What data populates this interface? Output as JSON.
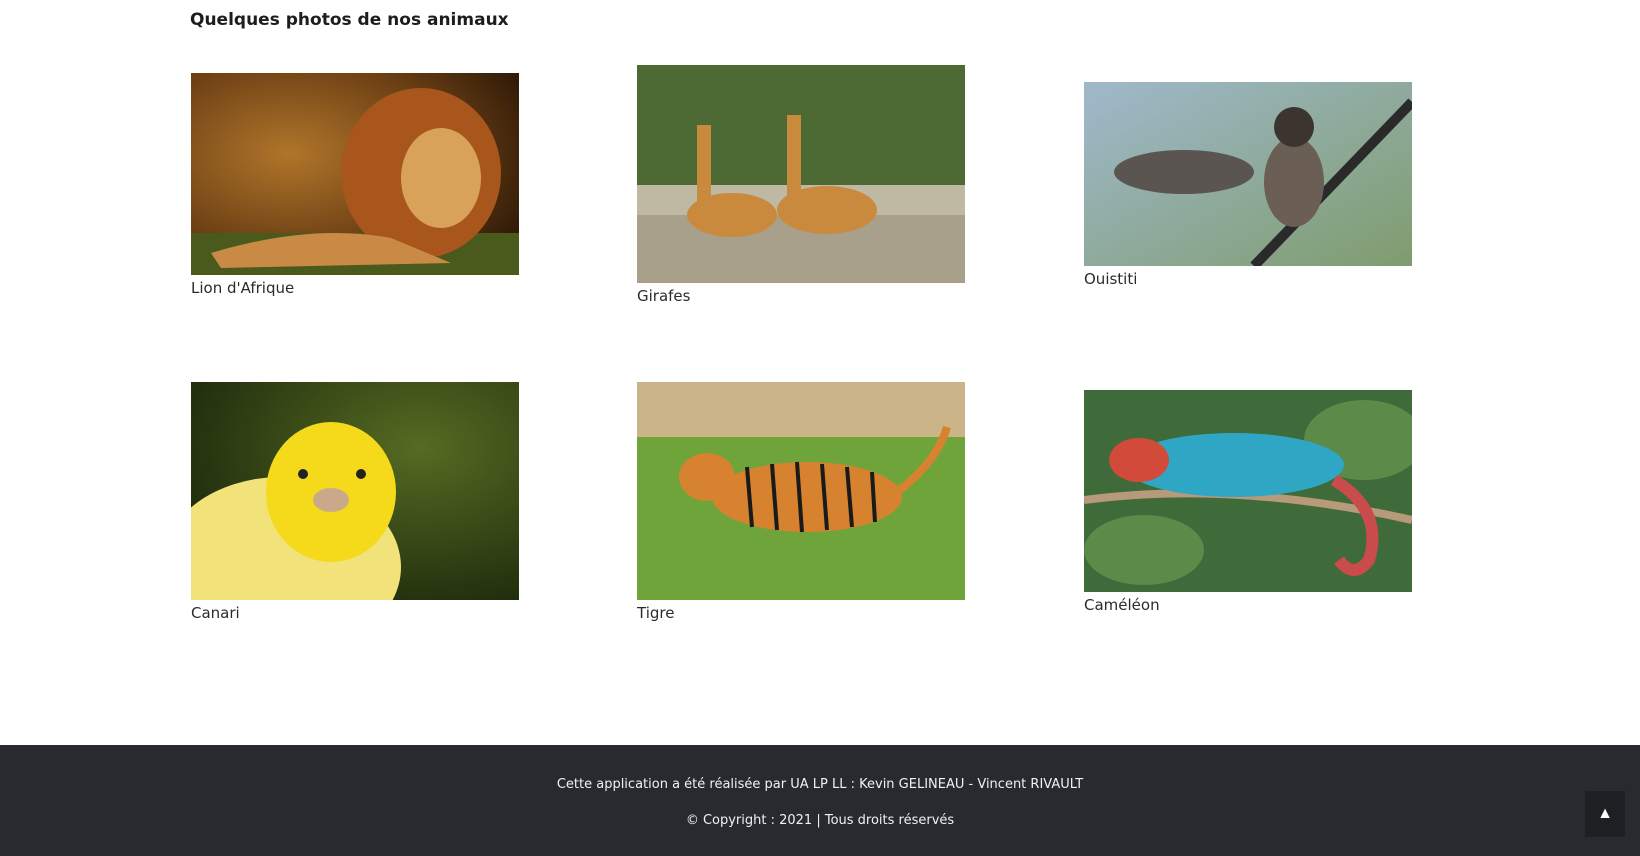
{
  "gallery": {
    "title": "Quelques photos de nos animaux",
    "items": [
      {
        "caption": "Lion d'Afrique"
      },
      {
        "caption": "Girafes"
      },
      {
        "caption": "Ouistiti"
      },
      {
        "caption": "Canari"
      },
      {
        "caption": "Tigre"
      },
      {
        "caption": "Caméléon"
      }
    ]
  },
  "footer": {
    "credit": "Cette application a été réalisée par UA LP LL : Kevin GELINEAU - Vincent RIVAULT",
    "copyright": "© Copyright : 2021 | Tous droits réservés",
    "background": "#292a30"
  },
  "back_to_top": {
    "icon": "up-triangle-icon",
    "glyph": "▲"
  }
}
